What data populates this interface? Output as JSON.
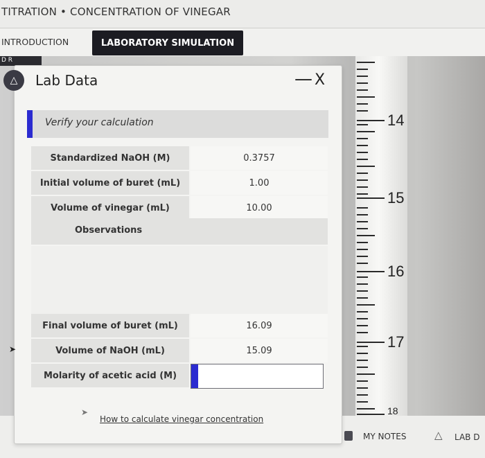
{
  "header": {
    "title": "TITRATION • CONCENTRATION OF VINEGAR"
  },
  "tabs": [
    {
      "label": "INTRODUCTION",
      "active": false
    },
    {
      "label": "LABORATORY SIMULATION",
      "active": true
    }
  ],
  "background_strip": {
    "text": "D R"
  },
  "panel": {
    "icon": "flask-icon",
    "title": "Lab Data",
    "minimize_label": "—",
    "close_label": "X",
    "verify_heading": "Verify your calculation",
    "rows_top": [
      {
        "label": "Standardized NaOH (M)",
        "value": "0.3757"
      },
      {
        "label": "Initial volume of buret (mL)",
        "value": "1.00"
      },
      {
        "label": "Volume of vinegar (mL)",
        "value": "10.00"
      }
    ],
    "observations_label": "Observations",
    "rows_bottom": [
      {
        "label": "Final volume of buret (mL)",
        "value": "16.09"
      },
      {
        "label": "Volume of NaOH (mL)",
        "value": "15.09"
      }
    ],
    "molarity": {
      "label": "Molarity of acetic acid (M)",
      "value": "",
      "placeholder": ""
    },
    "help_link": "How to calculate vinegar concentration"
  },
  "buret": {
    "labels": [
      "14",
      "15",
      "16",
      "17",
      "18"
    ]
  },
  "bottom_bar": {
    "notes_label": "MY NOTES",
    "lab_data_label": "LAB D"
  },
  "colors": {
    "accent": "#2b2bd0",
    "tab_active_bg": "#1c1c22"
  }
}
